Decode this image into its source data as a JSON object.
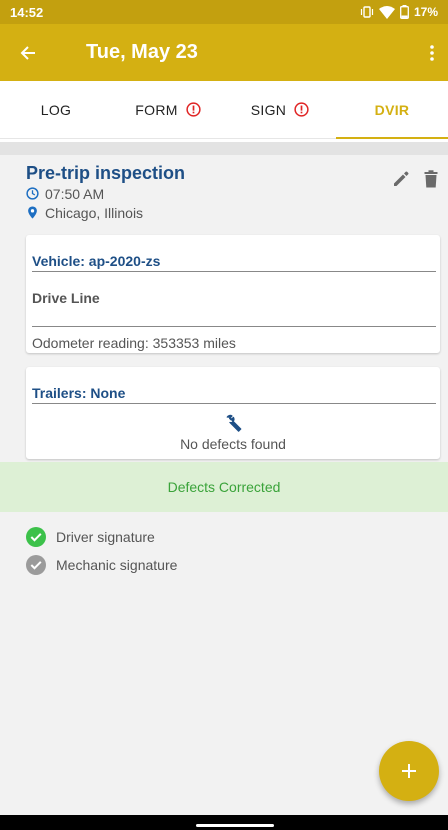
{
  "status_bar": {
    "time": "14:52",
    "battery": "17%"
  },
  "app_bar": {
    "title": "Tue, May 23"
  },
  "tabs": [
    {
      "label": "LOG",
      "alert": false,
      "active": false
    },
    {
      "label": "FORM",
      "alert": true,
      "active": false
    },
    {
      "label": "SIGN",
      "alert": true,
      "active": false
    },
    {
      "label": "DVIR",
      "alert": false,
      "active": true
    }
  ],
  "inspection": {
    "title": "Pre-trip inspection",
    "time": "07:50 AM",
    "location": "Chicago, Illinois"
  },
  "vehicle_card": {
    "heading": "Vehicle: ap-2020-zs",
    "subheading": "Drive Line",
    "odometer": "Odometer reading: 353353 miles"
  },
  "trailers_card": {
    "heading": "Trailers: None",
    "status": "No defects found"
  },
  "defects_corrected": "Defects Corrected",
  "signatures": [
    {
      "label": "Driver signature",
      "signed": true
    },
    {
      "label": "Mechanic signature",
      "signed": false
    }
  ],
  "colors": {
    "accent": "#d4b012",
    "title_blue": "#1e4f86",
    "success_green": "#3cc14a",
    "alert_red": "#e02424"
  },
  "icons": {
    "back": "arrow-left-icon",
    "more": "more-vert-icon",
    "alert": "alert-circle-icon",
    "clock": "clock-icon",
    "location": "location-pin-icon",
    "edit": "pencil-icon",
    "delete": "trash-icon",
    "wrench": "wrench-icon",
    "check": "check-circle-icon",
    "add": "plus-icon"
  }
}
